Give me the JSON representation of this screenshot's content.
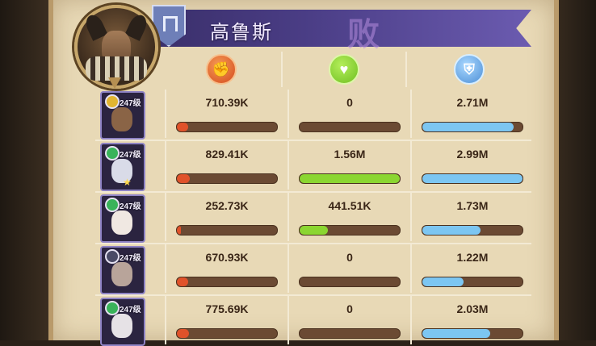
{
  "hero": {
    "name": "高鲁斯",
    "result_glyph": "败"
  },
  "columns": [
    {
      "key": "damage",
      "icon": "damage-fist-icon",
      "color": "#e0522a"
    },
    {
      "key": "healing",
      "icon": "heal-heart-icon",
      "color": "#8bd631"
    },
    {
      "key": "tanked",
      "icon": "shield-defense-icon",
      "color": "#7cc6f2"
    }
  ],
  "rows": [
    {
      "level": "247级",
      "badge": "gold",
      "star": false,
      "damage": "710.39K",
      "damage_pct": 0.11,
      "healing": "0",
      "healing_pct": 0,
      "tanked": "2.71M",
      "tanked_pct": 0.91
    },
    {
      "level": "247级",
      "badge": "green",
      "star": true,
      "damage": "829.41K",
      "damage_pct": 0.13,
      "healing": "1.56M",
      "healing_pct": 1.0,
      "tanked": "2.99M",
      "tanked_pct": 1.0
    },
    {
      "level": "247级",
      "badge": "green",
      "star": false,
      "damage": "252.73K",
      "damage_pct": 0.04,
      "healing": "441.51K",
      "healing_pct": 0.28,
      "tanked": "1.73M",
      "tanked_pct": 0.58
    },
    {
      "level": "247级",
      "badge": "dark",
      "star": false,
      "damage": "670.93K",
      "damage_pct": 0.11,
      "healing": "0",
      "healing_pct": 0,
      "tanked": "1.22M",
      "tanked_pct": 0.41
    },
    {
      "level": "247级",
      "badge": "green",
      "star": false,
      "damage": "775.69K",
      "damage_pct": 0.12,
      "healing": "0",
      "healing_pct": 0,
      "tanked": "2.03M",
      "tanked_pct": 0.68
    }
  ]
}
